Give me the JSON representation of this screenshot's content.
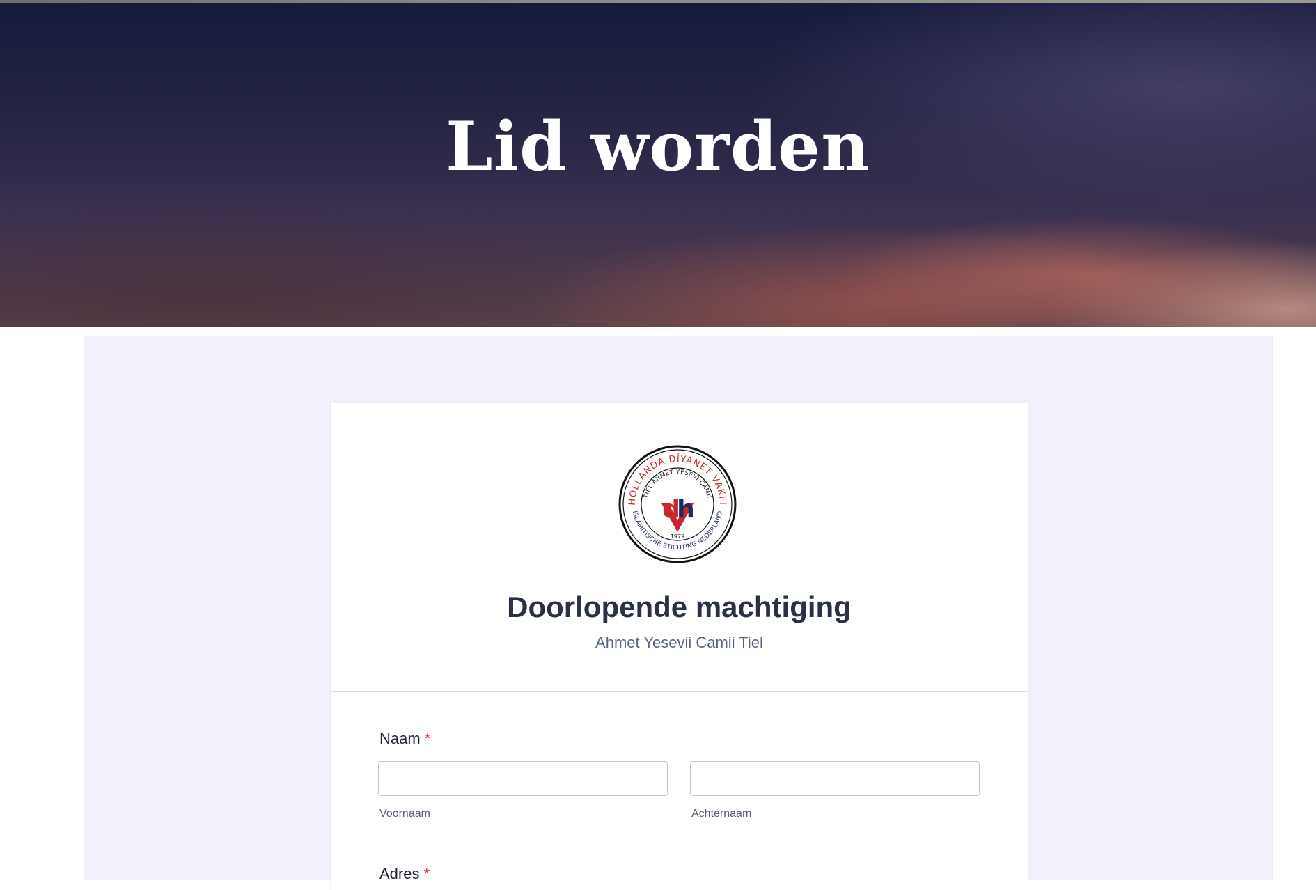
{
  "hero": {
    "title": "Lid worden"
  },
  "form": {
    "logo": {
      "ring_top_text": "HOLLANDA DİYANET VAKFI",
      "ring_inner_text": "TIEL AHMET YESEVİ CAMİİ",
      "ring_bottom_text": "ISLAMITISCHE STICHTING NEDERLAND",
      "year": "1979",
      "monogram": "dh"
    },
    "title": "Doorlopende machtiging",
    "subtitle": "Ahmet Yesevii Camii Tiel",
    "fields": {
      "naam": {
        "label": "Naam",
        "required_marker": "*",
        "first_name_sublabel": "Voornaam",
        "last_name_sublabel": "Achternaam",
        "first_name_value": "",
        "last_name_value": ""
      },
      "adres": {
        "label": "Adres",
        "required_marker": "*"
      }
    }
  },
  "colors": {
    "panel_background": "#f1f1fb",
    "title_color": "#2a3146",
    "subtitle_color": "#5a6580",
    "required_color": "#d0312d",
    "logo_red": "#c8282d",
    "logo_navy": "#1d2a5e"
  }
}
